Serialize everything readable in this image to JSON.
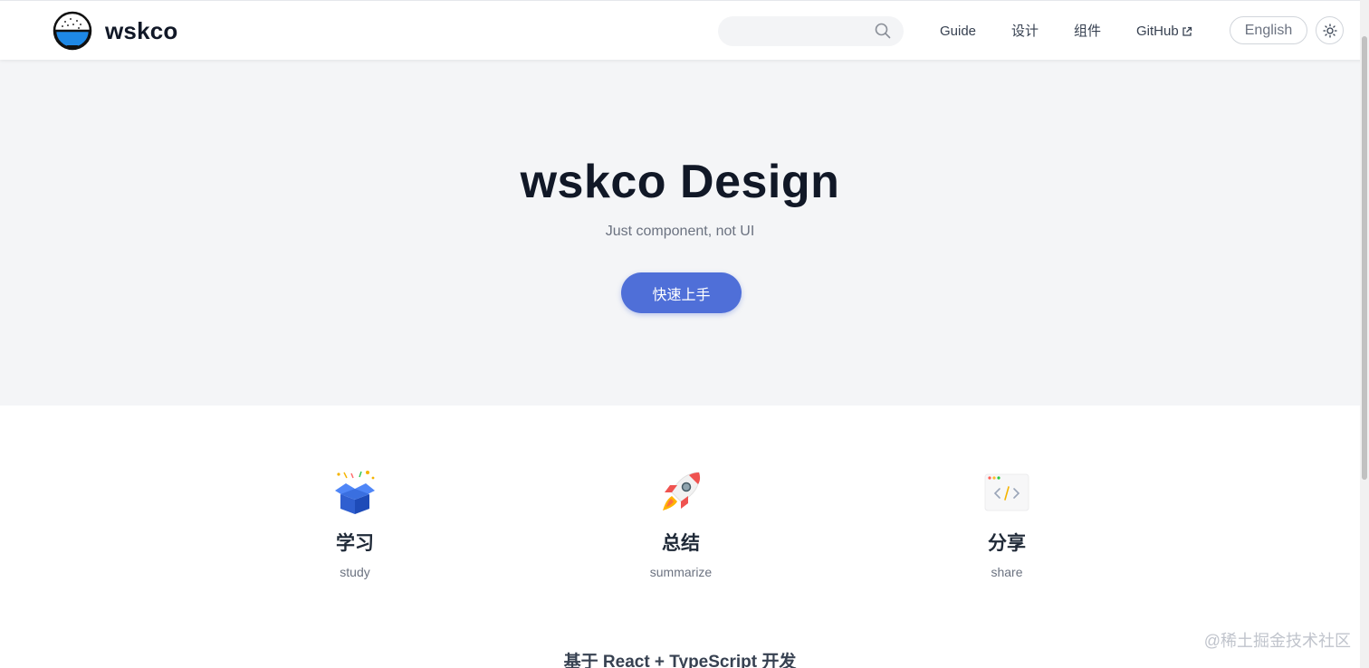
{
  "header": {
    "logo_text": "wskco",
    "search": {
      "value": "",
      "placeholder": ""
    },
    "nav": {
      "guide": "Guide",
      "design": "设计",
      "components": "组件",
      "github": "GitHub"
    },
    "language_button": "English"
  },
  "hero": {
    "title": "wskco Design",
    "subtitle": "Just component, not UI",
    "cta_label": "快速上手"
  },
  "features": [
    {
      "icon": "gift-box-icon",
      "title": "学习",
      "desc": "study"
    },
    {
      "icon": "rocket-icon",
      "title": "总结",
      "desc": "summarize"
    },
    {
      "icon": "code-window-icon",
      "title": "分享",
      "desc": "share"
    }
  ],
  "tech_line": "基于 React + TypeScript 开发",
  "watermark": "@稀土掘金技术社区",
  "colors": {
    "accent": "#4f6fd8",
    "hero_bg": "#f4f5f7",
    "logo_blue": "#1e88e5"
  }
}
